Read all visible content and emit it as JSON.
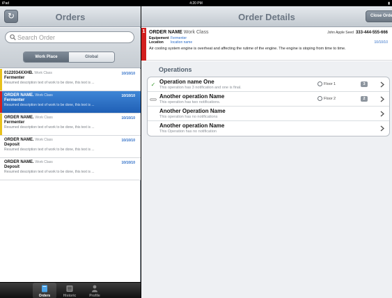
{
  "status_bar": {
    "device": "iPad",
    "time": "4:20 PM",
    "battery": ""
  },
  "left_panel": {
    "title": "Orders",
    "refresh_icon": "refresh-icon",
    "search": {
      "placeholder": "Search Order",
      "value": ""
    },
    "segments": [
      {
        "label": "Work Place",
        "active": true
      },
      {
        "label": "Global",
        "active": false
      }
    ],
    "orders": [
      {
        "name": "0122034XXHB.",
        "class": "Work Class",
        "date": "10/10/10",
        "equipment": "Fermenter",
        "description": "Resumed description text  of work to be done, this text is ...",
        "accent": "#e8c11c",
        "selected": false
      },
      {
        "name": "ORDER NAME.",
        "class": "Work Class",
        "date": "10/10/10",
        "equipment": "Fermenter",
        "description": "Resumed description text  of work to be done, this text is ...",
        "accent": "#d21f1f",
        "selected": true
      },
      {
        "name": "ORDER NAME.",
        "class": "Work Class",
        "date": "10/10/10",
        "equipment": "Fermenter",
        "description": "Resumed description text  of work to be done, this text is ...",
        "accent": "#e8c11c",
        "selected": false
      },
      {
        "name": "ORDER NAME.",
        "class": "Work Class",
        "date": "10/10/10",
        "equipment": "Deposit",
        "description": "Resumed description text  of work to be done, this text is ...",
        "accent": "",
        "selected": false
      },
      {
        "name": "ORDER NAME.",
        "class": "Work Class",
        "date": "10/10/10",
        "equipment": "Deposit",
        "description": "Resumed description text  of work to be done, this text is ...",
        "accent": "",
        "selected": false
      }
    ],
    "tabs": [
      {
        "label": "Orders",
        "icon": "orders-icon",
        "active": true
      },
      {
        "label": "Historic",
        "icon": "historic-icon",
        "active": false
      },
      {
        "label": "Profile",
        "icon": "profile-icon",
        "active": false
      }
    ]
  },
  "right_panel": {
    "title": "Order Details",
    "close_label": "Close Orde",
    "order": {
      "priority": "1",
      "name": "ORDER NAME",
      "class": "Work Class",
      "equipment_label": "Equipement",
      "equipment_value": "Fermenter",
      "location_label": "Location",
      "location_value": "location name",
      "user": "John Apple Seed",
      "phone": "333-444-555-666",
      "date": "10/10/10",
      "description": "Air cooling system engine is overheat and affecting the rutime of the engine. The engine is stoping from time to time."
    },
    "operations_title": "Operations",
    "operations": [
      {
        "name": "Operation name One",
        "description": "This operation has 3 notification and one is final.",
        "floor": "Floor 1",
        "badge": "3",
        "status": "done"
      },
      {
        "name": "Another operation Name",
        "description": "This operation has two notifications.",
        "floor": "Floor 2",
        "badge": "2",
        "status": "pending"
      },
      {
        "name": "Another Operation Name",
        "description": "This operation has no notifications",
        "floor": "",
        "badge": "",
        "status": ""
      },
      {
        "name": "Another operation Name",
        "description": "This Operation has no notification",
        "floor": "",
        "badge": "",
        "status": ""
      }
    ]
  },
  "colors": {
    "accent_blue": "#2a6bc6",
    "selected_row": "#2f72c6",
    "priority_red": "#d21f1f",
    "warning_yellow": "#e8c11c",
    "check_green": "#3a9b2f"
  }
}
